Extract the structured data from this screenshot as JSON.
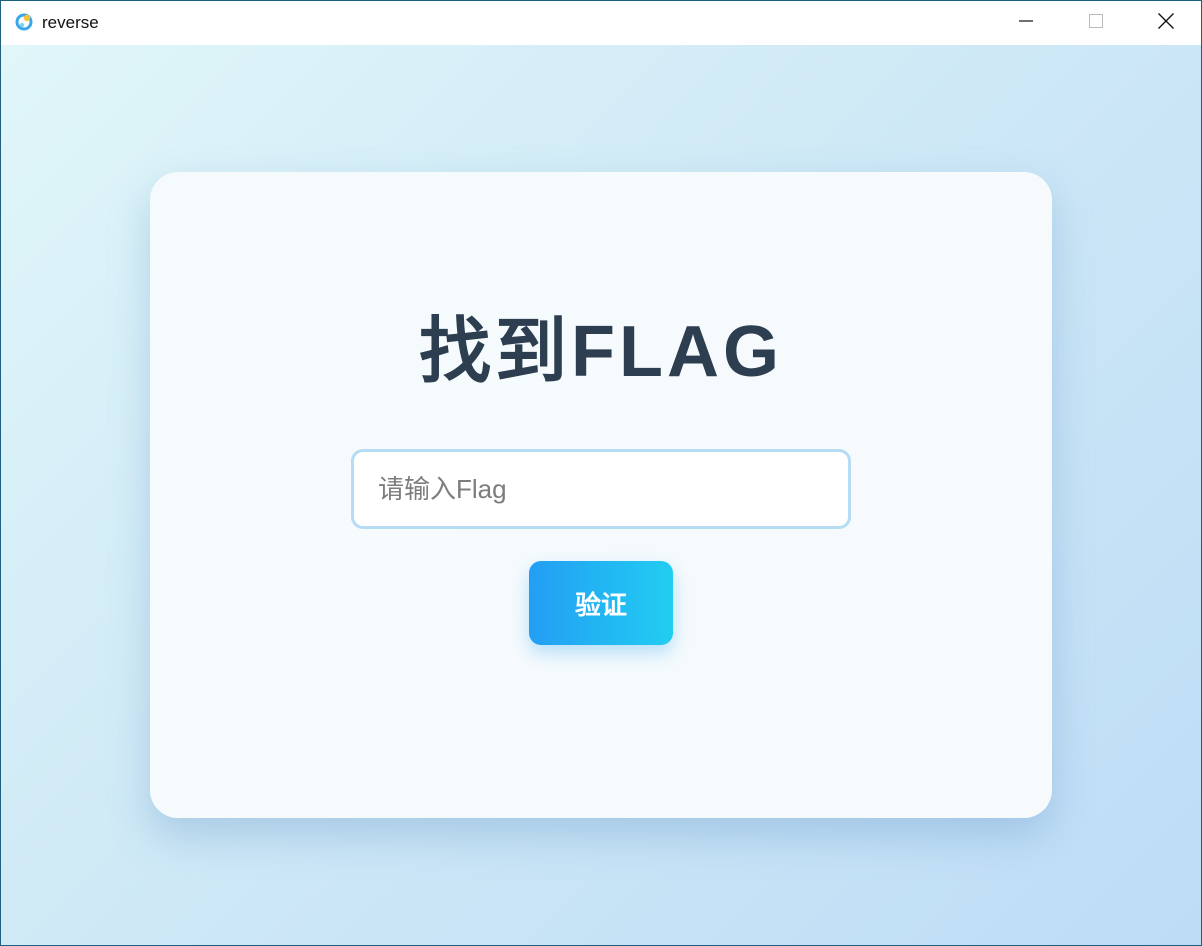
{
  "window": {
    "title": "reverse",
    "icon": "app-logo-icon",
    "controls": [
      "minimize-icon",
      "maximize-icon",
      "close-icon"
    ]
  },
  "main": {
    "heading": "找到FLAG",
    "input": {
      "placeholder": "请输入Flag",
      "value": ""
    },
    "verify_label": "验证"
  },
  "colors": {
    "heading": "#2c3e50",
    "button_start": "#239ef3",
    "button_end": "#22cdf1",
    "input_border": "#b6dcf3"
  }
}
